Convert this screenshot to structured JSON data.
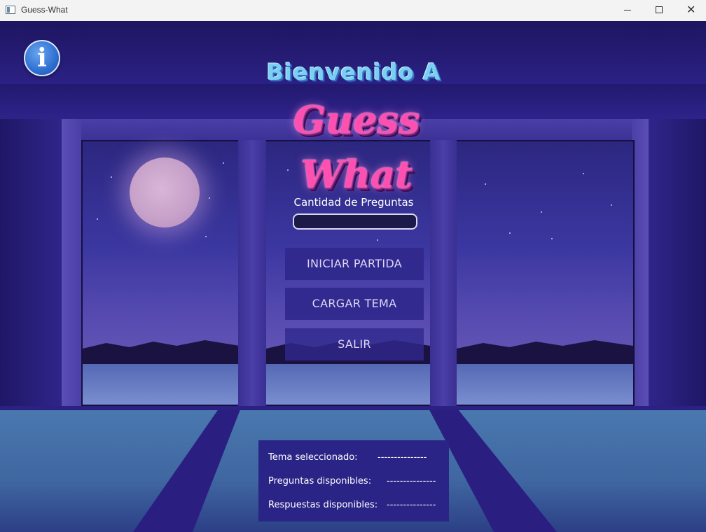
{
  "window": {
    "title": "Guess-What",
    "minimize_icon": "minimize-icon",
    "maximize_icon": "maximize-icon",
    "close_icon": "close-icon",
    "close_glyph": "✕"
  },
  "header": {
    "info_glyph": "i",
    "welcome_text": "Bienvenido A",
    "logo_text": "Guess What"
  },
  "form": {
    "quantity_label": "Cantidad de Preguntas",
    "quantity_value": ""
  },
  "menu": {
    "start_label": "INICIAR PARTIDA",
    "load_label": "CARGAR TEMA",
    "exit_label": "SALIR"
  },
  "status": {
    "topic_label": "Tema seleccionado:",
    "topic_value": "---------------",
    "questions_label": "Preguntas disponibles:",
    "questions_value": "---------------",
    "answers_label": "Respuestas disponibles:",
    "answers_value": "---------------"
  },
  "colors": {
    "accent_pink": "#ff4fb0",
    "accent_blue": "#7ad0f0",
    "button_bg": "#30288c",
    "panel_bg": "#2b2487"
  }
}
